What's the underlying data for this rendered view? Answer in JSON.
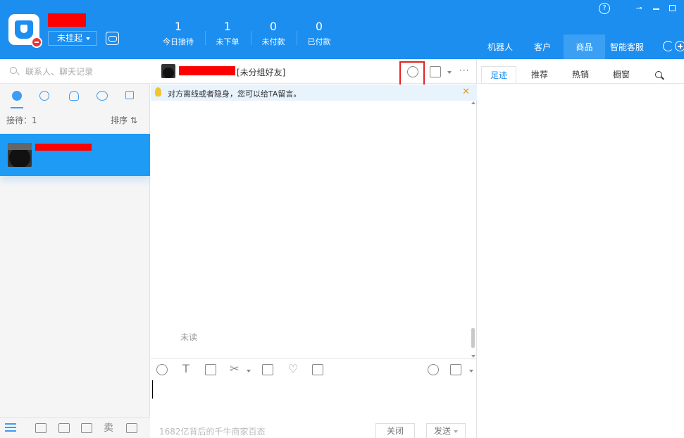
{
  "header": {
    "status_label": "未挂起",
    "stats": [
      {
        "value": "1",
        "label": "今日接待"
      },
      {
        "value": "1",
        "label": "未下单"
      },
      {
        "value": "0",
        "label": "未付款"
      },
      {
        "value": "0",
        "label": "已付款"
      }
    ],
    "tabs": [
      {
        "label": "机器人"
      },
      {
        "label": "客户"
      },
      {
        "label": "商品",
        "active": true
      },
      {
        "label": "智能客服"
      }
    ],
    "window_controls": {
      "help": "?"
    }
  },
  "sidebar": {
    "search_placeholder": "联系人、聊天记录",
    "tabs": [
      "chat-icon",
      "clock-icon",
      "person-icon",
      "group-icon",
      "org-icon"
    ],
    "reception_label": "接待：1",
    "sort_label": "排序 ⇅",
    "bottom_icons": [
      "menu-icon",
      "share-icon",
      "mail-icon",
      "shop-icon",
      "sell-icon",
      "layout-icon"
    ],
    "sell_glyph": "卖"
  },
  "chat": {
    "contact_group": "[未分组好友]",
    "offline_notice": "对方离线或者隐身，您可以给TA留言。",
    "notice_close": "✕",
    "more": "···",
    "unread_label": "未读",
    "slogan": "1682亿背后的千牛商家百态",
    "close_button": "关闭",
    "send_button": "发送",
    "toolbar": {
      "text_glyph": "T",
      "heart_glyph": "♡",
      "scissors_glyph": "✂"
    }
  },
  "right_panel": {
    "tabs": [
      {
        "label": "足迹",
        "active": true
      },
      {
        "label": "推荐"
      },
      {
        "label": "热销"
      },
      {
        "label": "橱窗"
      }
    ]
  },
  "colors": {
    "header_bg": "#1c8ef0",
    "selected_contact": "#1d9bf5",
    "accent": "#3c9df5",
    "highlight_box": "#e52222",
    "redaction": "#ff0000"
  }
}
